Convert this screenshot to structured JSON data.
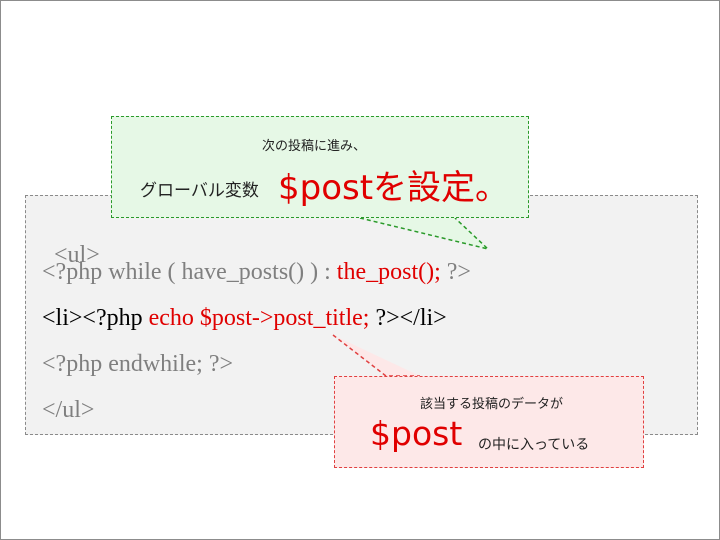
{
  "code": {
    "lines": [
      {
        "segments": [
          {
            "text": "<ul>",
            "color": "gray"
          }
        ]
      },
      {
        "segments": [
          {
            "text": "<?php while ( have_posts() ) : ",
            "color": "gray"
          },
          {
            "text": "the_post();",
            "color": "red"
          },
          {
            "text": " ?>",
            "color": "gray"
          }
        ]
      },
      {
        "segments": [
          {
            "text": "<li><?php ",
            "color": "black"
          },
          {
            "text": "echo $post->post_title;",
            "color": "red"
          },
          {
            "text": " ?></li>",
            "color": "black"
          }
        ]
      },
      {
        "segments": [
          {
            "text": "<?php endwhile; ?>",
            "color": "gray"
          }
        ]
      },
      {
        "segments": [
          {
            "text": "</ul>",
            "color": "gray"
          }
        ]
      }
    ]
  },
  "callout_top": {
    "line1": "次の投稿に進み、",
    "line2_prefix": "グローバル変数",
    "line2_highlight": "$postを設定。"
  },
  "callout_bottom": {
    "line1": "該当する投稿のデータが",
    "highlight": "$post",
    "suffix": "の中に入っている"
  },
  "colors": {
    "accent_red": "#e00000",
    "code_gray": "#7f7f7f",
    "green_border": "#2a9a2a",
    "green_fill": "#e6f8e6",
    "red_border": "#e04040",
    "red_fill": "#fde8e8"
  }
}
